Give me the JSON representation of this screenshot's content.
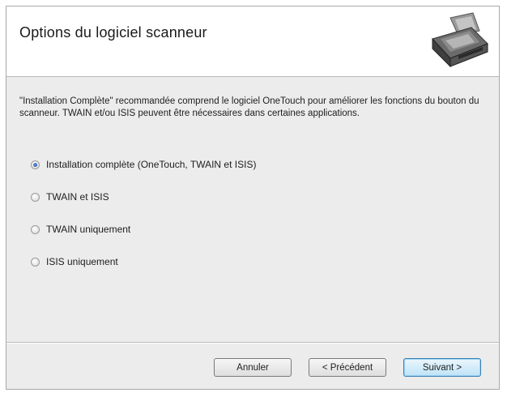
{
  "dialog": {
    "title": "Options du logiciel scanneur",
    "header_icon": "scanner-icon",
    "description": "\"Installation Complète\" recommandée comprend le logiciel OneTouch pour améliorer les fonctions du bouton du scanneur. TWAIN et/ou ISIS peuvent être nécessaires dans certaines applications."
  },
  "options": [
    {
      "label": "Installation complète (OneTouch, TWAIN et ISIS)",
      "selected": true
    },
    {
      "label": "TWAIN et ISIS",
      "selected": false
    },
    {
      "label": "TWAIN uniquement",
      "selected": false
    },
    {
      "label": "ISIS uniquement",
      "selected": false
    }
  ],
  "buttons": {
    "cancel": "Annuler",
    "previous": "< Précédent",
    "next": "Suivant >"
  },
  "colors": {
    "selected_radio": "#2a5fb0",
    "default_button_border": "#3c7fb1"
  }
}
